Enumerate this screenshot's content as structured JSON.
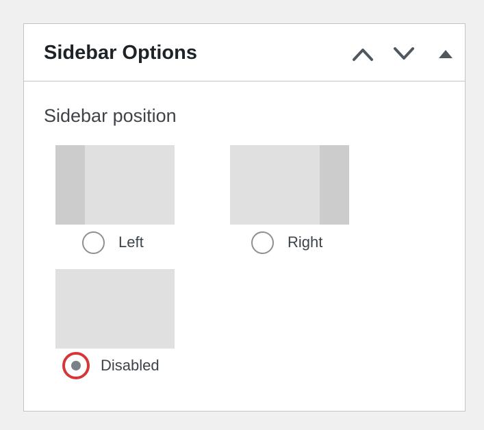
{
  "panel": {
    "title": "Sidebar Options",
    "controls": {
      "move_up": "chevron-up-icon",
      "move_down": "chevron-down-icon",
      "toggle": "triangle-up-icon"
    }
  },
  "sidebar_position": {
    "label": "Sidebar position",
    "selected": "Disabled",
    "options": [
      {
        "label": "Left",
        "checked": false
      },
      {
        "label": "Right",
        "checked": false
      },
      {
        "label": "Disabled",
        "checked": true
      }
    ]
  },
  "colors": {
    "page_background": "#f0f0f1",
    "panel_border": "#c3c4c7",
    "thumbnail_main": "#e0e0e0",
    "thumbnail_sidebar": "#cccccc",
    "selected_ring": "#d63638",
    "selected_dot": "#7a8088",
    "text": "#1d2327"
  }
}
